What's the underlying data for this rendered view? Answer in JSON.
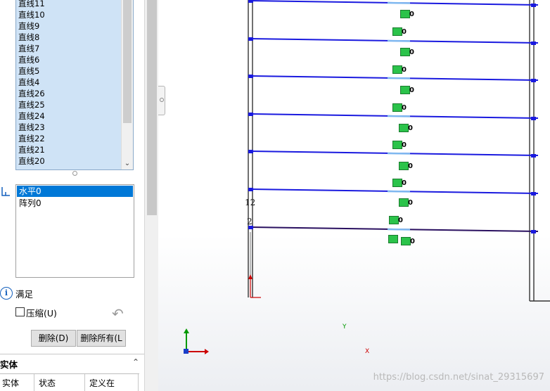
{
  "line_list": {
    "items": [
      "直线11",
      "直线10",
      "直线9",
      "直线8",
      "直线7",
      "直线6",
      "直线5",
      "直线4",
      "直线26",
      "直线25",
      "直线24",
      "直线23",
      "直线22",
      "直线21",
      "直线20"
    ]
  },
  "relations_list": {
    "items": [
      "水平0",
      "阵列0"
    ],
    "selected_index": 0
  },
  "status": {
    "text": "满足"
  },
  "compress_checkbox": {
    "label": "压缩(U)",
    "checked": false
  },
  "buttons": {
    "delete": "删除(D)",
    "delete_all": "删除所有(L"
  },
  "entities_section": {
    "title": "实体",
    "columns": [
      "实体",
      "状态",
      "定义在"
    ]
  },
  "viewport": {
    "dim_label_1": "12",
    "dim_label_2": "2",
    "constraint_value": "0",
    "axis_x": "X",
    "axis_y": "Y",
    "watermark": "https://blog.csdn.net/sinat_29315697"
  },
  "colors": {
    "selection_blue": "#0078d7",
    "list_highlight": "#cfe3f6",
    "sketch_line": "#1a1adf",
    "constraint_green": "#2bc34a"
  }
}
